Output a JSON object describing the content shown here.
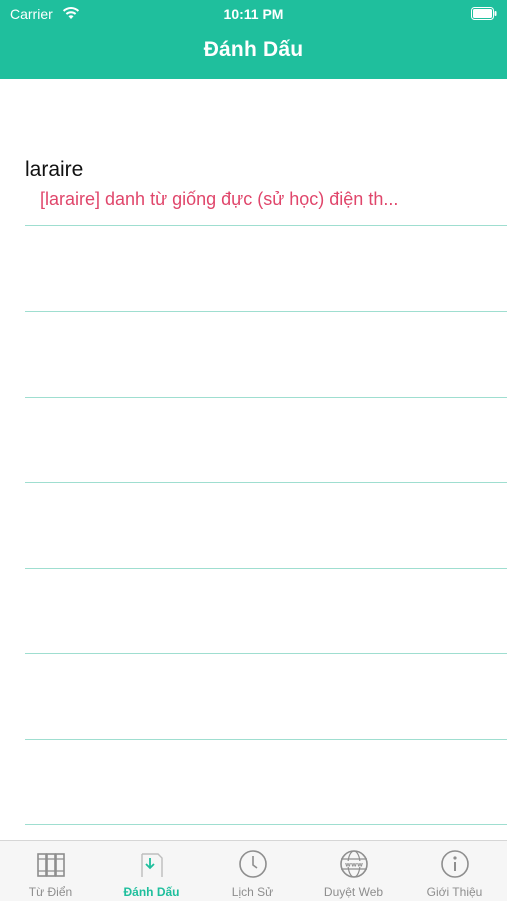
{
  "status_bar": {
    "carrier": "Carrier",
    "time": "10:11 PM"
  },
  "header": {
    "title": "Đánh Dấu"
  },
  "bookmarks": [
    {
      "word": "laraire",
      "definition": "[laraire]   danh từ giống đực   (sử học) điện th..."
    }
  ],
  "tabbar": {
    "tabs": [
      {
        "label": "Từ Điển",
        "icon": "books-icon"
      },
      {
        "label": "Đánh Dấu",
        "icon": "bookmark-icon",
        "active": true
      },
      {
        "label": "Lịch Sử",
        "icon": "clock-icon"
      },
      {
        "label": "Duyệt Web",
        "icon": "globe-www-icon"
      },
      {
        "label": "Giới Thiệu",
        "icon": "info-icon"
      }
    ]
  },
  "colors": {
    "accent": "#1fbf9d",
    "definition": "#e0466b",
    "separator": "#9fded0"
  }
}
